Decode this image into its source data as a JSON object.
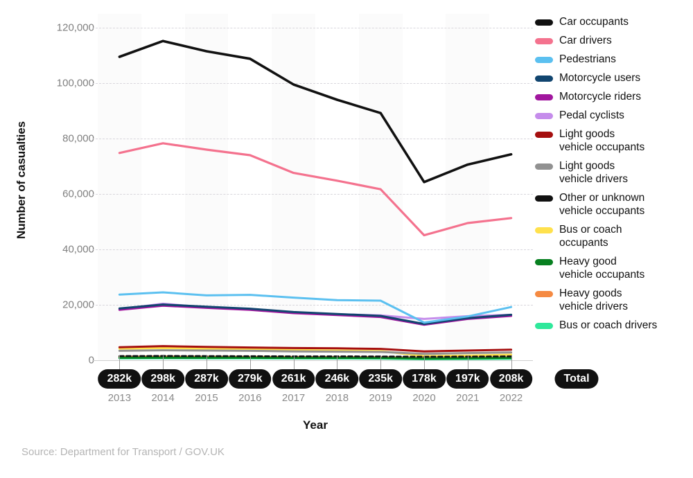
{
  "chart_data": {
    "type": "line",
    "title": "",
    "xlabel": "Year",
    "ylabel": "Number of casualties",
    "categories": [
      "2013",
      "2014",
      "2015",
      "2016",
      "2017",
      "2018",
      "2019",
      "2020",
      "2021",
      "2022"
    ],
    "ylim": [
      0,
      125000
    ],
    "yticks": [
      0,
      20000,
      40000,
      60000,
      80000,
      100000,
      120000
    ],
    "ytick_labels": [
      "0",
      "20,000",
      "40,000",
      "60,000",
      "80,000",
      "100,000",
      "120,000"
    ],
    "grid": "horizontal-dashed",
    "legend_position": "right",
    "totals_row_label": "Total",
    "totals": [
      "282k",
      "298k",
      "287k",
      "279k",
      "261k",
      "246k",
      "235k",
      "178k",
      "197k",
      "208k"
    ],
    "series": [
      {
        "name": "Car occupants",
        "color": "#111111",
        "width": 3.6,
        "dash": "none",
        "values": [
          109500,
          115200,
          111500,
          108800,
          99500,
          94000,
          89200,
          64300,
          70600,
          74300
        ]
      },
      {
        "name": "Car drivers",
        "color": "#F4728E",
        "width": 3.2,
        "dash": "none",
        "values": [
          74800,
          78300,
          76000,
          74000,
          67600,
          64800,
          61700,
          45100,
          49500,
          51300
        ]
      },
      {
        "name": "Pedestrians",
        "color": "#5BC0F0",
        "width": 3.0,
        "dash": "none",
        "values": [
          23700,
          24500,
          23400,
          23600,
          22600,
          21700,
          21500,
          13600,
          15800,
          19200
        ]
      },
      {
        "name": "Motorcycle users",
        "color": "#11456F",
        "width": 3.0,
        "dash": "none",
        "values": [
          18700,
          20100,
          19300,
          18600,
          17400,
          16700,
          16000,
          13100,
          15200,
          16400
        ]
      },
      {
        "name": "Motorcycle riders",
        "color": "#A1169E",
        "width": 3.0,
        "dash": "none",
        "values": [
          18200,
          19700,
          18900,
          18200,
          17000,
          16300,
          15600,
          12800,
          14900,
          16000
        ]
      },
      {
        "name": "Pedal cyclists",
        "color": "#C58CEB",
        "width": 3.0,
        "dash": "none",
        "values": [
          18400,
          20400,
          19100,
          18500,
          17300,
          16600,
          16200,
          14900,
          15900,
          16400
        ]
      },
      {
        "name": "Light goods\nvehicle occupants",
        "color": "#A50F0F",
        "width": 3.0,
        "dash": "none",
        "values": [
          4700,
          5100,
          4800,
          4600,
          4400,
          4300,
          4100,
          3200,
          3500,
          3800
        ]
      },
      {
        "name": "Light goods\nvehicle drivers",
        "color": "#919191",
        "width": 3.0,
        "dash": "none",
        "values": [
          3400,
          3600,
          3500,
          3400,
          3200,
          3100,
          3000,
          2300,
          2600,
          2800
        ]
      },
      {
        "name": "Other or unknown\nvehicle occupants",
        "color": "#111111",
        "width": 2.6,
        "dash": "6 4",
        "values": [
          1500,
          1550,
          1500,
          1450,
          1400,
          1400,
          1350,
          1250,
          1300,
          1400
        ]
      },
      {
        "name": "Bus or coach\noccupants",
        "color": "#FFE14D",
        "width": 3.0,
        "dash": "none",
        "values": [
          4200,
          4400,
          4200,
          4000,
          3700,
          3500,
          3300,
          1500,
          1700,
          2000
        ]
      },
      {
        "name": "Heavy good\n vehicle occupants",
        "color": "#078020",
        "width": 3.0,
        "dash": "none",
        "values": [
          900,
          900,
          900,
          900,
          850,
          850,
          800,
          600,
          700,
          800
        ]
      },
      {
        "name": "Heavy goods\nvehicle drivers",
        "color": "#F58A42",
        "width": 3.0,
        "dash": "none",
        "values": [
          1250,
          1300,
          1250,
          1200,
          1150,
          1100,
          1050,
          800,
          900,
          1000
        ]
      },
      {
        "name": "Bus or coach drivers",
        "color": "#2FE89B",
        "width": 3.0,
        "dash": "none",
        "values": [
          700,
          720,
          700,
          680,
          650,
          630,
          600,
          380,
          450,
          520
        ]
      }
    ]
  },
  "axis": {
    "y_title": "Number of casualties",
    "x_title": "Year"
  },
  "footer": {
    "source": "Source: Department for Transport / GOV.UK"
  }
}
